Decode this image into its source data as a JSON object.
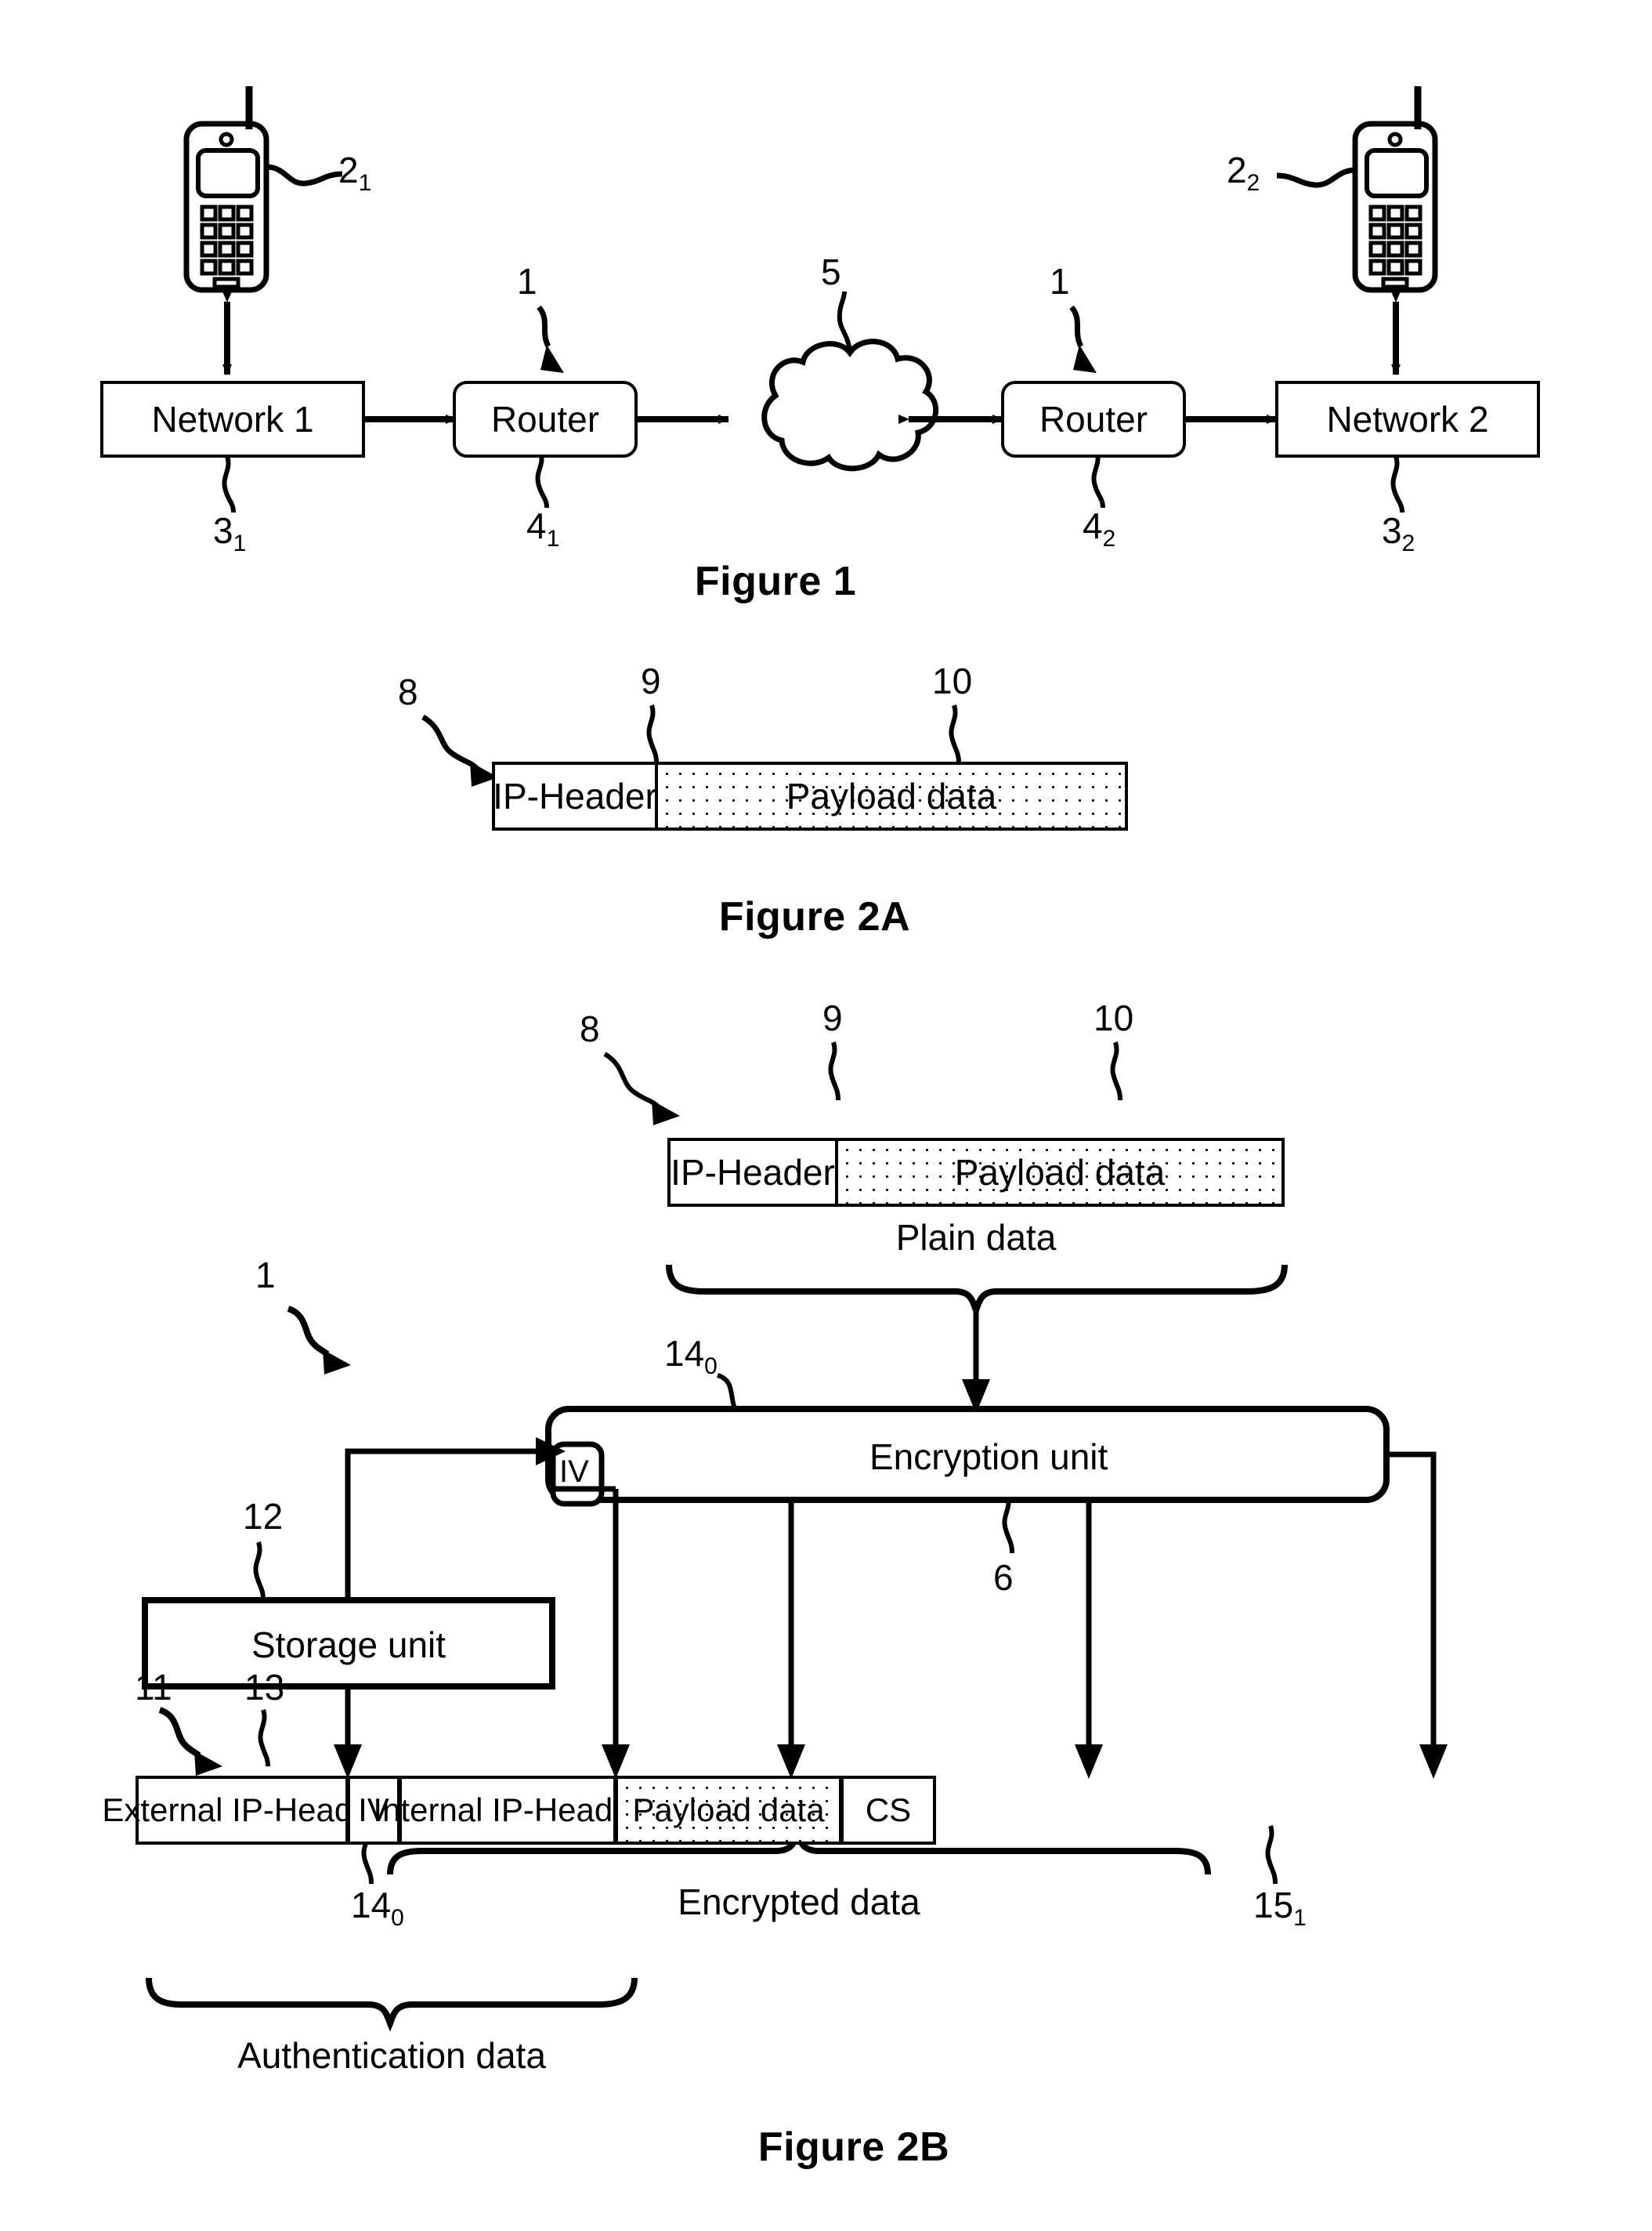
{
  "figures": [
    {
      "id": "figure-1",
      "title": "Figure 1",
      "nodes": {
        "network_left": "Network 1",
        "router_left": "Router",
        "router_right": "Router",
        "network_right": "Network 2"
      },
      "ref_labels": {
        "phone_left": "2",
        "phone_left_sub": "1",
        "phone_right": "2",
        "phone_right_sub": "2",
        "router_left_top": "1",
        "router_right_top": "1",
        "cloud": "5",
        "network_left_bottom": "3",
        "network_left_bottom_sub": "1",
        "router_left_bottom": "4",
        "router_left_bottom_sub": "1",
        "router_right_bottom": "4",
        "router_right_bottom_sub": "2",
        "network_right_bottom": "3",
        "network_right_bottom_sub": "2"
      }
    },
    {
      "id": "figure-2a",
      "title": "Figure 2A",
      "packet": {
        "ref": "8",
        "cells": [
          {
            "label": "IP-Header",
            "ref": "9",
            "fill": "plain"
          },
          {
            "label": "Payload data",
            "ref": "10",
            "fill": "dotted"
          }
        ]
      }
    },
    {
      "id": "figure-2b",
      "title": "Figure 2B",
      "ref_device": "1",
      "input_packet": {
        "ref": "8",
        "caption": "Plain data",
        "cells": [
          {
            "label": "IP-Header",
            "ref": "9",
            "fill": "plain"
          },
          {
            "label": "Payload data",
            "ref": "10",
            "fill": "dotted"
          }
        ]
      },
      "units": {
        "encryption_unit": {
          "label": "Encryption unit",
          "ref": "6"
        },
        "iv_register": {
          "label": "IV",
          "ref": "14",
          "ref_sub": "0"
        },
        "storage_unit": {
          "label": "Storage unit",
          "ref": "12"
        }
      },
      "output_packet": {
        "ref": "11",
        "cells": [
          {
            "label": "External IP-Header",
            "ref": "13",
            "fill": "plain"
          },
          {
            "label": "IV",
            "ref": "14",
            "ref_sub": "0",
            "fill": "plain"
          },
          {
            "label": "Internal IP-Header",
            "ref": "",
            "fill": "plain"
          },
          {
            "label": "Payload data",
            "ref": "",
            "fill": "dotted"
          },
          {
            "label": "CS",
            "ref": "15",
            "ref_sub": "1",
            "fill": "plain"
          }
        ],
        "braces": [
          {
            "label": "Encrypted data"
          },
          {
            "label": "Authentication data"
          }
        ]
      }
    }
  ]
}
